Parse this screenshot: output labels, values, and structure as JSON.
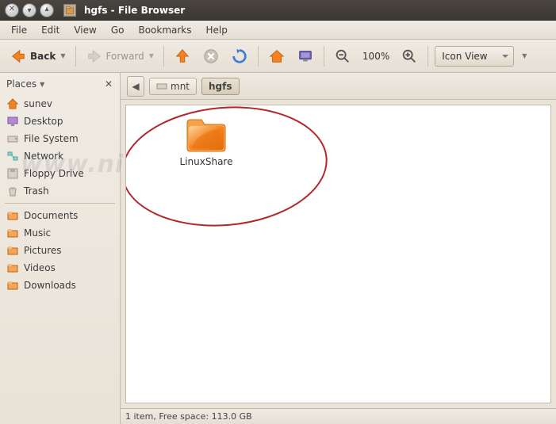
{
  "titlebar": {
    "title": "hgfs - File Browser"
  },
  "menubar": {
    "file": "File",
    "edit": "Edit",
    "view": "View",
    "go": "Go",
    "bookmarks": "Bookmarks",
    "help": "Help"
  },
  "toolbar": {
    "back": "Back",
    "forward": "Forward",
    "zoom": "100%",
    "view_mode": "Icon View"
  },
  "sidebar": {
    "header": "Places",
    "items": [
      {
        "icon": "home-icon",
        "label": "sunev"
      },
      {
        "icon": "desktop-icon",
        "label": "Desktop"
      },
      {
        "icon": "drive-icon",
        "label": "File System"
      },
      {
        "icon": "network-icon",
        "label": "Network"
      },
      {
        "icon": "floppy-icon",
        "label": "Floppy Drive"
      },
      {
        "icon": "trash-icon",
        "label": "Trash"
      }
    ],
    "items2": [
      {
        "icon": "folder-icon",
        "label": "Documents"
      },
      {
        "icon": "folder-icon",
        "label": "Music"
      },
      {
        "icon": "folder-icon",
        "label": "Pictures"
      },
      {
        "icon": "folder-icon",
        "label": "Videos"
      },
      {
        "icon": "folder-icon",
        "label": "Downloads"
      }
    ]
  },
  "pathbar": {
    "crumb1": "mnt",
    "crumb2": "hgfs"
  },
  "content": {
    "folder_label": "LinuxShare"
  },
  "statusbar": {
    "text": "1 item, Free space: 113.0 GB"
  },
  "watermark": "www.niubba.net",
  "colors": {
    "accent_orange": "#f58220",
    "annotation_red": "#b4262a"
  }
}
